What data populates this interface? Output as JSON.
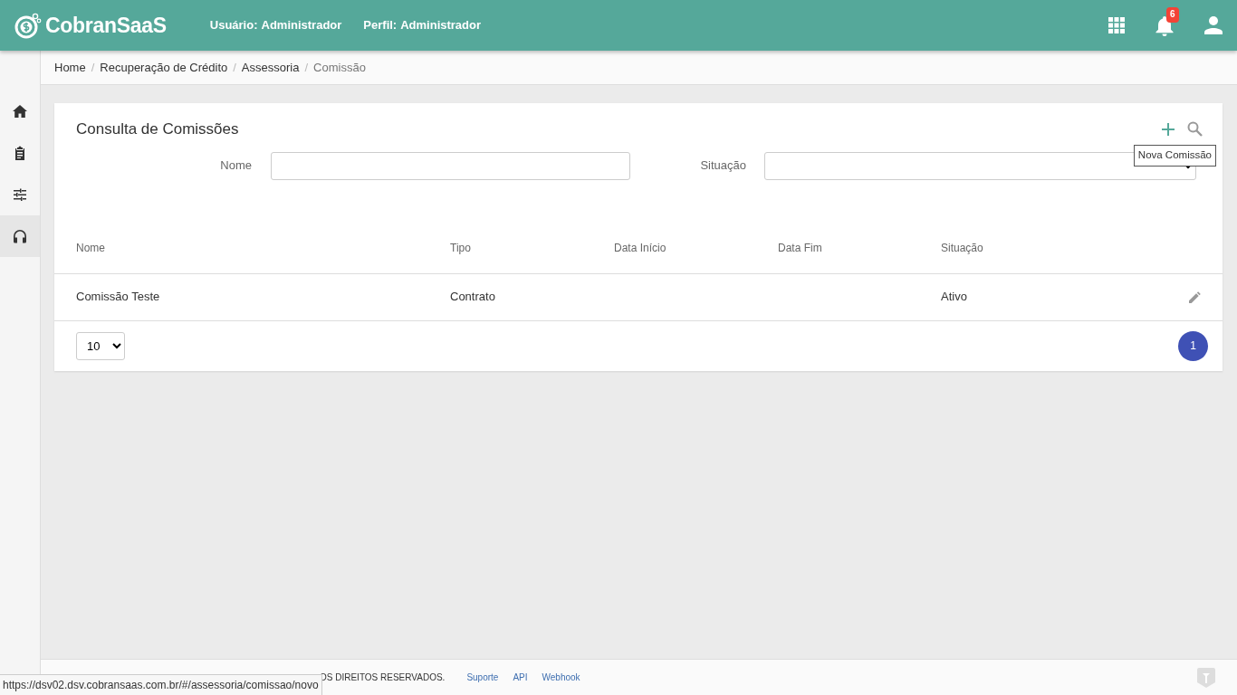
{
  "header": {
    "logo": "CobranSaaS",
    "user_label": "Usuário:",
    "user_value": "Administrador",
    "profile_label": "Perfil:",
    "profile_value": "Administrador",
    "notifications": "6"
  },
  "sidebar": {
    "items": [
      {
        "kind": "home",
        "selected": false
      },
      {
        "kind": "clipboard",
        "selected": false
      },
      {
        "kind": "sliders",
        "selected": false
      },
      {
        "kind": "headset",
        "selected": true
      }
    ]
  },
  "breadcrumb": [
    {
      "label": "Home"
    },
    {
      "separator": "/",
      "label": "Recuperação de Crédito"
    },
    {
      "separator": "/",
      "label": "Assessoria"
    },
    {
      "separator": "/",
      "label": "Comissão"
    }
  ],
  "panel": {
    "title": "Consulta de Comissões",
    "tooltip": "Nova Comissão",
    "filters": [
      {
        "label": "Nome",
        "kind": "text"
      },
      {
        "label": "Situação",
        "kind": "select"
      }
    ],
    "table": {
      "columns": [
        "Nome",
        "Tipo",
        "Data Início",
        "Data Fim",
        "Situação"
      ],
      "rows": [
        {
          "cells": [
            "Comissão Teste",
            "Contrato",
            "",
            "",
            "Ativo"
          ]
        }
      ]
    },
    "page_size": "10",
    "pages": [
      {
        "label": "1",
        "selected": true
      }
    ]
  },
  "footer": {
    "text": "OS DIREITOS RESERVADOS.",
    "links": [
      "Suporte",
      "API",
      "Webhook"
    ]
  },
  "status_url": "https://dsv02.dsv.cobransaas.com.br/#/assessoria/comissao/novo"
}
